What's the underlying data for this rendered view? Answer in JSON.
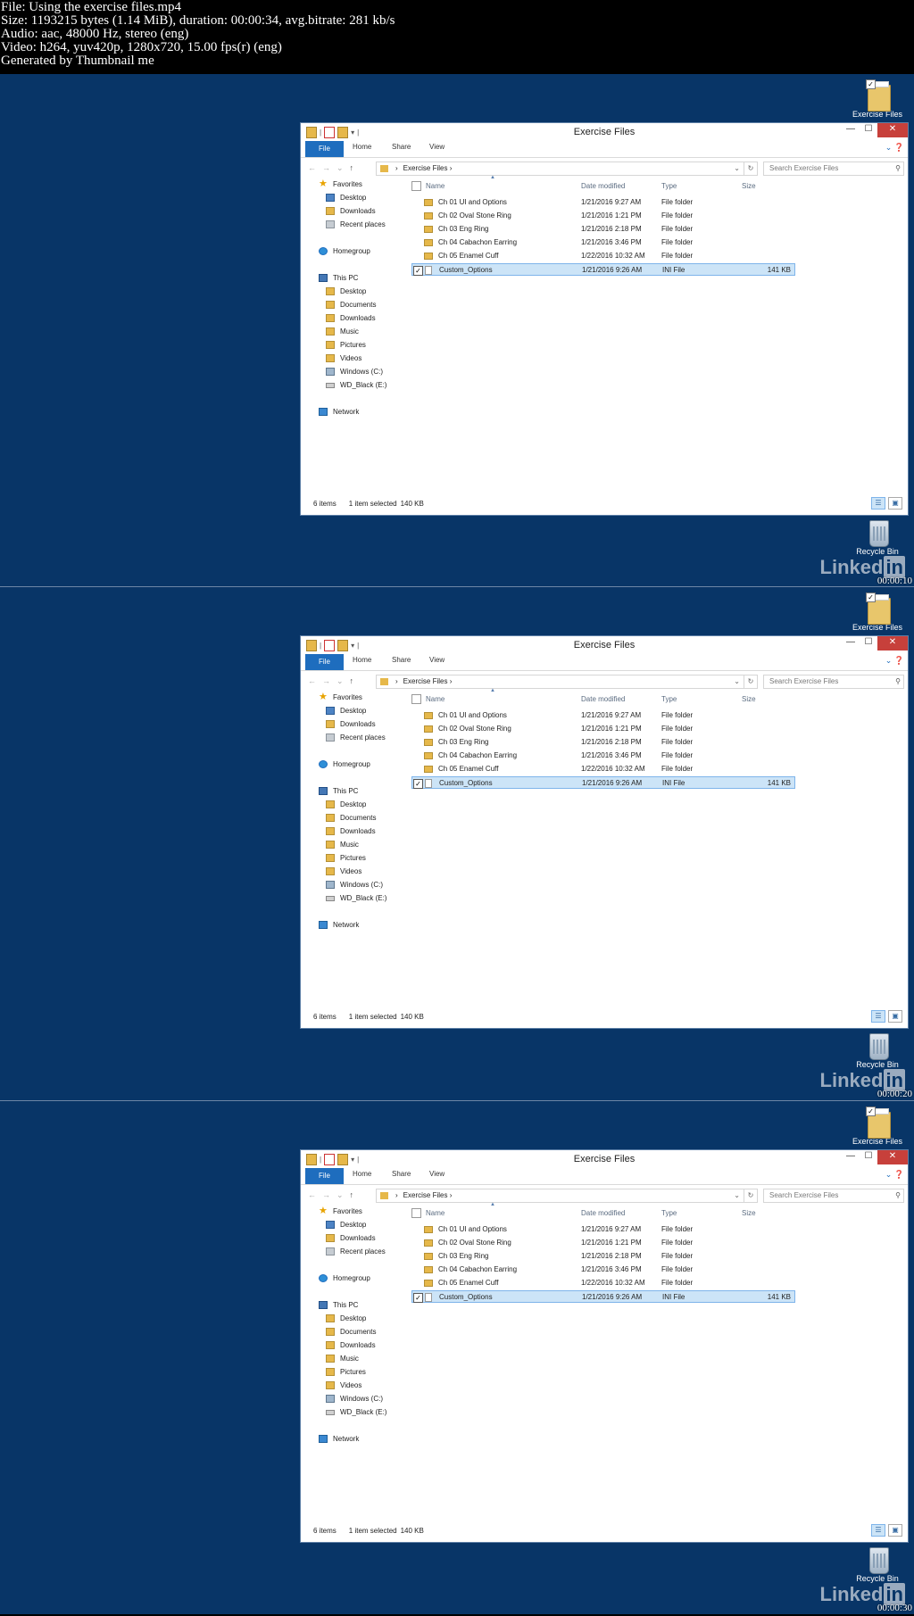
{
  "meta": {
    "lines": [
      "File: Using the exercise files.mp4",
      "Size: 1193215 bytes (1.14 MiB), duration: 00:00:34, avg.bitrate: 281 kb/s",
      "Audio: aac, 48000 Hz, stereo (eng)",
      "Video: h264, yuv420p, 1280x720, 15.00 fps(r) (eng)",
      "Generated by Thumbnail me"
    ]
  },
  "desktop": {
    "exercise_icon_label": "Exercise Files",
    "recycle_label": "Recycle Bin",
    "watermark_main": "Linked",
    "watermark_in": "in",
    "background": "#083567"
  },
  "window": {
    "title": "Exercise Files",
    "tabs": {
      "file": "File",
      "home": "Home",
      "share": "Share",
      "view": "View"
    },
    "address": "Exercise Files",
    "search_placeholder": "Search Exercise Files",
    "columns": {
      "name": "Name",
      "date": "Date modified",
      "type": "Type",
      "size": "Size"
    },
    "files": [
      {
        "name": "Ch 01 UI and Options",
        "date": "1/21/2016 9:27 AM",
        "type": "File folder",
        "size": ""
      },
      {
        "name": "Ch 02 Oval Stone Ring",
        "date": "1/21/2016 1:21 PM",
        "type": "File folder",
        "size": ""
      },
      {
        "name": "Ch 03 Eng Ring",
        "date": "1/21/2016 2:18 PM",
        "type": "File folder",
        "size": ""
      },
      {
        "name": "Ch 04 Cabachon Earring",
        "date": "1/21/2016 3:46 PM",
        "type": "File folder",
        "size": ""
      },
      {
        "name": "Ch 05 Enamel Cuff",
        "date": "1/22/2016 10:32 AM",
        "type": "File folder",
        "size": ""
      },
      {
        "name": "Custom_Options",
        "date": "1/21/2016 9:26 AM",
        "type": "INI File",
        "size": "141 KB"
      }
    ],
    "nav": {
      "favorites": "Favorites",
      "desktop": "Desktop",
      "downloads": "Downloads",
      "recent": "Recent places",
      "homegroup": "Homegroup",
      "thispc": "This PC",
      "pc_desktop": "Desktop",
      "documents": "Documents",
      "pc_downloads": "Downloads",
      "music": "Music",
      "pictures": "Pictures",
      "videos": "Videos",
      "windows_c": "Windows (C:)",
      "wd_black": "WD_Black (E:)",
      "network": "Network"
    },
    "status": {
      "items": "6 items",
      "selected": "1 item selected",
      "size": "140 KB"
    }
  },
  "frames": [
    {
      "timestamp": "00:00:10"
    },
    {
      "timestamp": "00:00:20"
    },
    {
      "timestamp": "00:00:30"
    }
  ]
}
